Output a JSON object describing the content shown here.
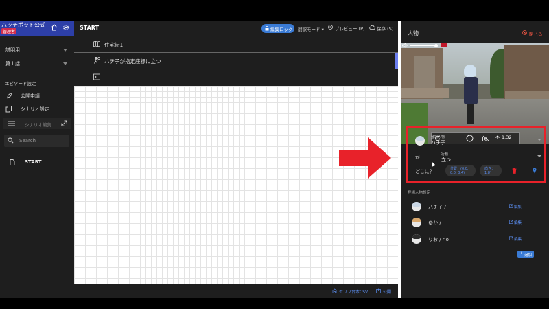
{
  "sidebar": {
    "brand_title": "ハッチポット公式",
    "brand_badge": "管理者",
    "select_1": "説明用",
    "select_2": "第１話",
    "section_label": "エピソード設定",
    "items": [
      {
        "label": "公開申請",
        "icon": "rocket-icon"
      },
      {
        "label": "シナリオ設定",
        "icon": "copy-icon"
      }
    ],
    "scenario_edit_label": "シナリオ編集",
    "search_placeholder": "Search",
    "start_label": "START"
  },
  "main": {
    "title": "START",
    "lock_label": "編集ロック",
    "translate_mode": "翻訳モード ▾",
    "preview_label": "プレビュー (P)",
    "save_label": "保存 (S)",
    "steps": [
      {
        "label": "住宅街1",
        "icon": "map-icon"
      },
      {
        "label": "ハチ子が指定座標に立つ",
        "icon": "walk-icon"
      },
      {
        "label": "",
        "icon": "terminal-icon"
      }
    ],
    "csv_label": "セリフ台本CSV",
    "export_label": "公開"
  },
  "panel": {
    "title": "人物",
    "close_label": "閉じる",
    "height_value": "1.32",
    "cast_label": "登場人物",
    "cast_value": "ハチ子",
    "ga_label": "が",
    "action_label": "行動",
    "action_value": "立つ",
    "where_label": "どこに？",
    "pos_line1": "位置：(0.0,",
    "pos_line2": "0.0, 3.4)",
    "dir_line1": "向き：",
    "dir_line2": "1.8°",
    "cast_section_label": "登場人物設定",
    "cast": [
      {
        "name": "ハチ子 /",
        "edit": "編集"
      },
      {
        "name": "ゆか /",
        "edit": "編集"
      },
      {
        "name": "りお / rio",
        "edit": "編集"
      }
    ],
    "add_label": "追加"
  },
  "colors": {
    "accent": "#3a7bd5",
    "highlight": "#e8222a",
    "brand": "#2d3fa8"
  }
}
